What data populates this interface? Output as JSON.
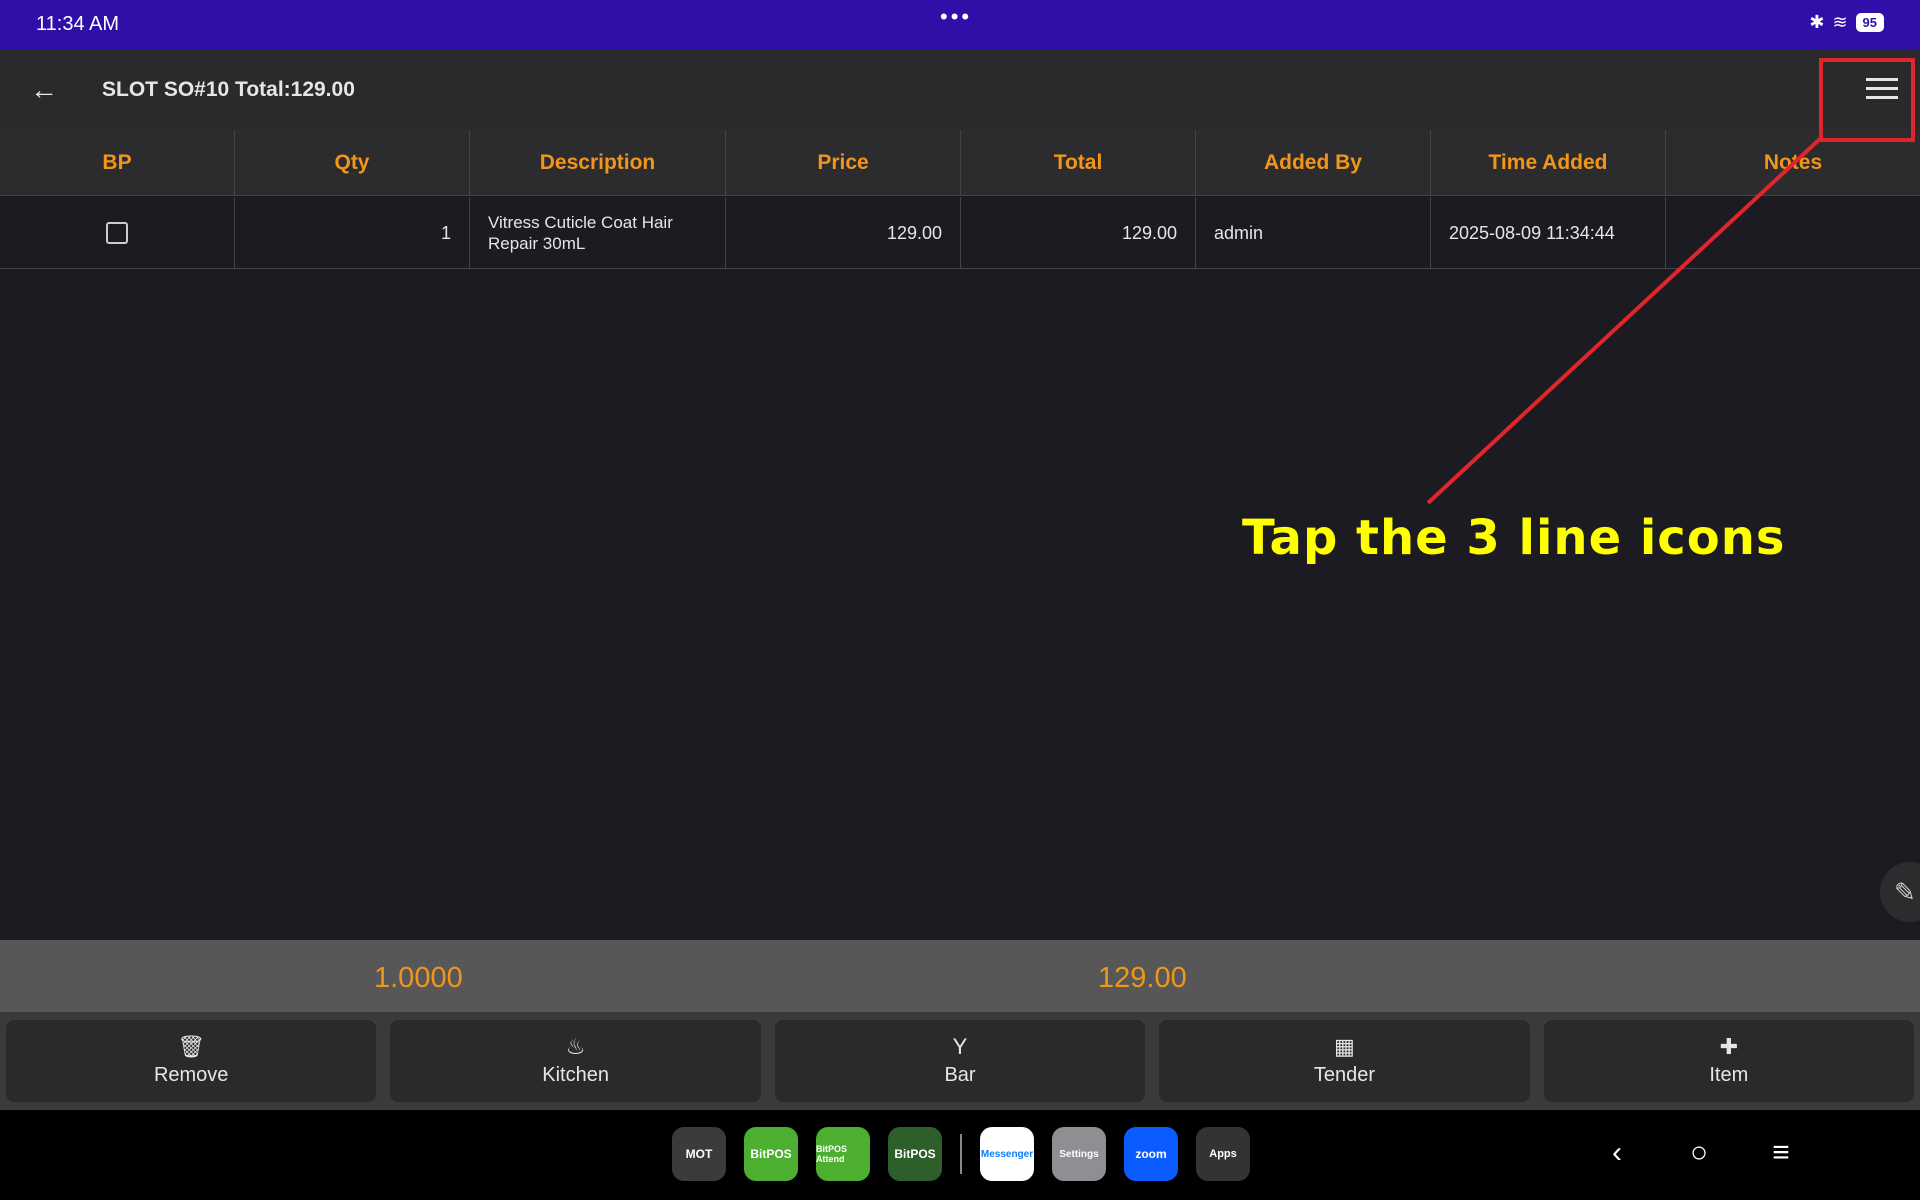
{
  "status": {
    "time": "11:34 AM",
    "battery": "95"
  },
  "appbar": {
    "title": "SLOT SO#10 Total:129.00"
  },
  "table": {
    "headers": [
      "BP",
      "Qty",
      "Description",
      "Price",
      "Total",
      "Added By",
      "Time Added",
      "Notes"
    ],
    "rows": [
      {
        "bp": "",
        "qty": "1",
        "description": "Vitress Cuticle Coat Hair Repair 30mL",
        "price": "129.00",
        "total": "129.00",
        "added_by": "admin",
        "time_added": "2025-08-09 11:34:44",
        "notes": ""
      }
    ]
  },
  "annotation": {
    "text": "Tap the 3 line icons",
    "color": "#ffff00",
    "box_color": "#e1262b"
  },
  "summary": {
    "qty": "1.0000",
    "amount": "129.00"
  },
  "actions": [
    {
      "label": "Remove",
      "icon": "trash-icon"
    },
    {
      "label": "Kitchen",
      "icon": "kitchen-icon"
    },
    {
      "label": "Bar",
      "icon": "cocktail-icon"
    },
    {
      "label": "Tender",
      "icon": "calculator-icon"
    },
    {
      "label": "Item",
      "icon": "plus-icon"
    }
  ],
  "dock": [
    "MOT",
    "BitPOS",
    "BitPOS Attend",
    "BitPOS",
    "Messenger",
    "Settings",
    "zoom",
    "Apps"
  ],
  "colors": {
    "accent": "#f0961a",
    "statusbar": "#2f0fa8"
  }
}
